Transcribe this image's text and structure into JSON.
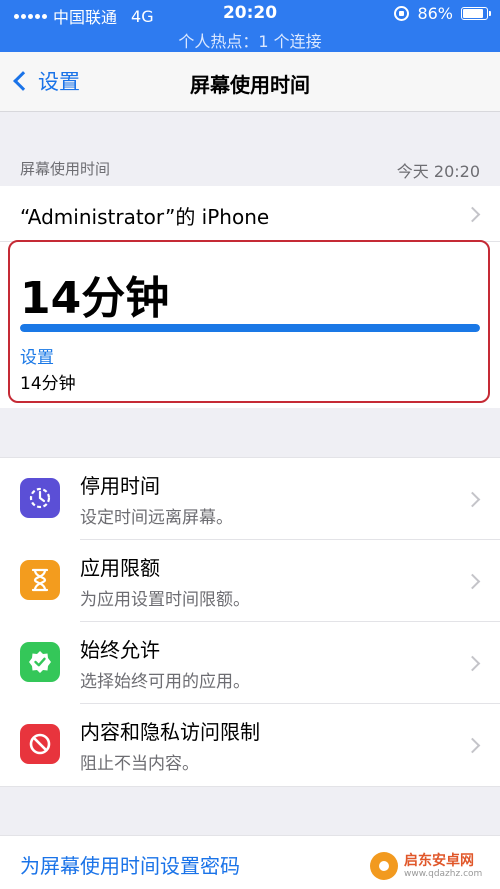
{
  "status_bar": {
    "carrier": "中国联通",
    "network": "4G",
    "time": "20:20",
    "battery_percent": "86%",
    "battery_level": 0.86,
    "hotspot_text": "个人热点：1 个连接"
  },
  "nav": {
    "back_label": "设置",
    "title": "屏幕使用时间"
  },
  "usage": {
    "section_label": "屏幕使用时间",
    "date_label": "今天 20:20",
    "device_name": "“Administrator”的 iPhone",
    "total": "14分钟",
    "bar_fraction": 1.0,
    "category": "设置",
    "category_time": "14分钟"
  },
  "features": [
    {
      "title": "停用时间",
      "subtitle": "设定时间远离屏幕。",
      "icon": "downtime-icon",
      "color": "#5b4fd6"
    },
    {
      "title": "应用限额",
      "subtitle": "为应用设置时间限额。",
      "icon": "hourglass-icon",
      "color": "#f39c1e"
    },
    {
      "title": "始终允许",
      "subtitle": "选择始终可用的应用。",
      "icon": "checkmark-badge-icon",
      "color": "#34c759"
    },
    {
      "title": "内容和隐私访问限制",
      "subtitle": "阻止不当内容。",
      "icon": "restriction-icon",
      "color": "#e8343d"
    }
  ],
  "passcode_link": "为屏幕使用时间设置密码",
  "watermark": {
    "name": "启东安卓网",
    "url": "www.qdazhz.com"
  }
}
